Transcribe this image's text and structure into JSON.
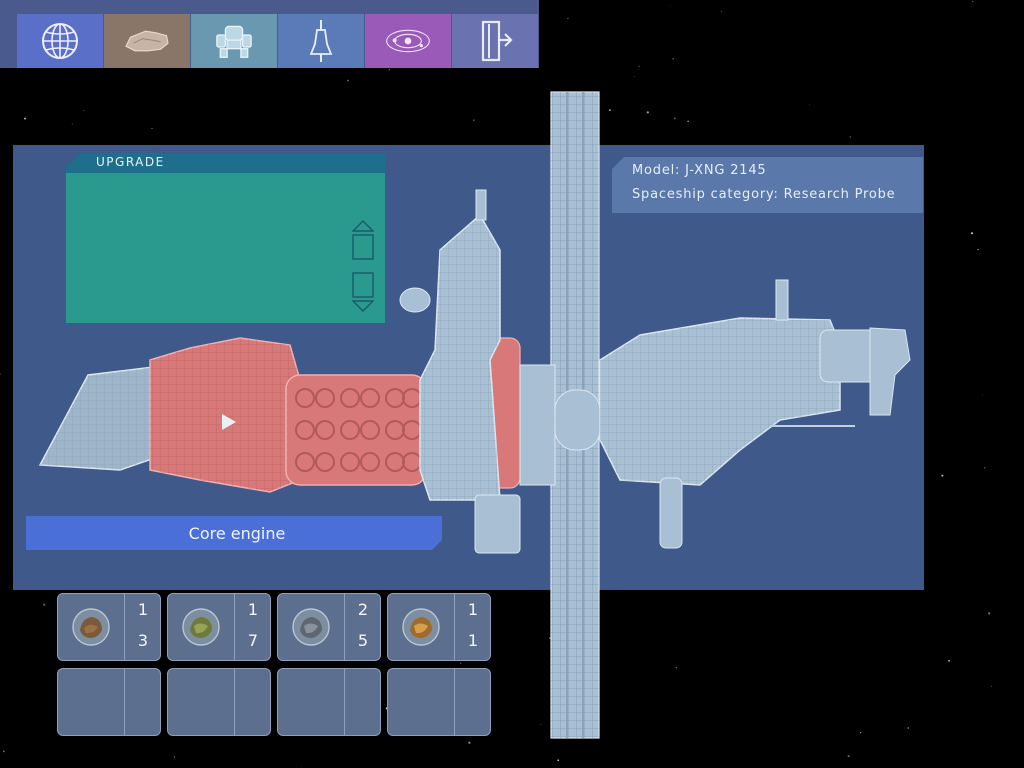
{
  "tabs": [
    {
      "name": "planet-globe-icon"
    },
    {
      "name": "terrain-icon"
    },
    {
      "name": "robot-icon"
    },
    {
      "name": "figure-icon"
    },
    {
      "name": "solar-system-icon"
    },
    {
      "name": "exit-door-icon"
    }
  ],
  "upgrade": {
    "title": "UPGRADE"
  },
  "ship_info": {
    "model": "Model: J-XNG 2145",
    "category": "Spaceship category: Research Probe"
  },
  "selected_module": "Core engine",
  "resources": [
    {
      "icon": "brown-mineral-icon",
      "top": "1",
      "bottom": "3"
    },
    {
      "icon": "green-mineral-icon",
      "top": "1",
      "bottom": "7"
    },
    {
      "icon": "gray-mineral-icon",
      "top": "2",
      "bottom": "5"
    },
    {
      "icon": "orange-mineral-icon",
      "top": "1",
      "bottom": "1"
    }
  ],
  "colors": {
    "panel": "#3f5a8a",
    "upgrade_box": "#2a9a8e",
    "highlight_module": "#d87878",
    "hull": "#a9c0d4",
    "selection_bar": "#4a70d8"
  }
}
